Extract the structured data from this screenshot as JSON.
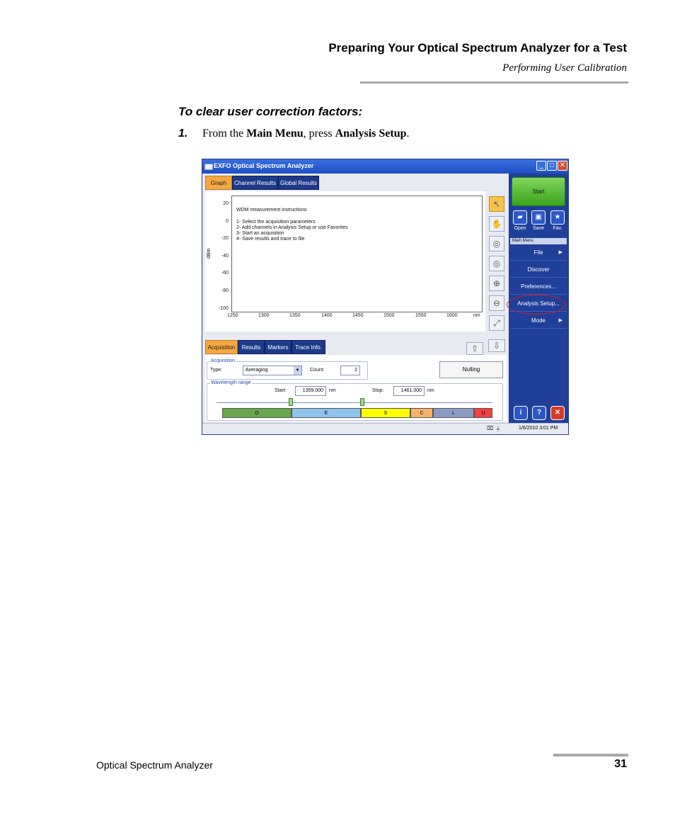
{
  "header": {
    "title": "Preparing Your Optical Spectrum Analyzer for a Test",
    "subtitle": "Performing User Calibration"
  },
  "procedure": {
    "title": "To clear user correction factors:",
    "step_number": "1.",
    "step_pre": "From the ",
    "step_bold1": "Main Menu",
    "step_mid": ", press ",
    "step_bold2": "Analysis Setup",
    "step_end": "."
  },
  "footer": {
    "product": "Optical Spectrum Analyzer",
    "page": "31"
  },
  "app": {
    "window_title": "EXFO Optical Spectrum Analyzer",
    "tabs": [
      "Graph",
      "Channel Results",
      "Global Results"
    ],
    "y_axis_label": "dBm",
    "y_ticks": [
      "20",
      "0",
      "-20",
      "-40",
      "-60",
      "-80",
      "-100"
    ],
    "x_ticks": [
      "1250",
      "1300",
      "1350",
      "1400",
      "1450",
      "1500",
      "1550",
      "1600"
    ],
    "x_unit": "nm",
    "instructions_title": "WDM measurement instructions",
    "instructions": [
      "1- Select the acquisition parameters",
      "2- Add channels in Analysis Setup or use Favorites",
      "3- Start an acquisition",
      "4- Save results and trace to file"
    ],
    "start_label": "Start",
    "quick_buttons": [
      "Open",
      "Save",
      "Fav."
    ],
    "main_menu_header": "Main Menu",
    "main_menu_items": [
      "File",
      "Discover",
      "Preferences...",
      "Analysis Setup...",
      "Mode"
    ],
    "bottom_tabs": [
      "Acquisition",
      "Results",
      "Markers",
      "Trace Info."
    ],
    "acquisition": {
      "group_label": "Acquisition",
      "type_label": "Type:",
      "type_value": "Averaging",
      "count_label": "Count:",
      "count_value": "2",
      "nulling_label": "Nulling"
    },
    "wavelength": {
      "group_label": "Wavelength range",
      "start_label": "Start:",
      "start_value": "1359.000",
      "stop_label": "Stop:",
      "stop_value": "1461.000",
      "unit": "nm"
    },
    "bands": [
      {
        "label": "O",
        "color": "#6aa84f"
      },
      {
        "label": "E",
        "color": "#8ec4ee"
      },
      {
        "label": "S",
        "color": "#ffff00"
      },
      {
        "label": "C",
        "color": "#f7b26b"
      },
      {
        "label": "L",
        "color": "#8c9cc4"
      },
      {
        "label": "U",
        "color": "#f04040"
      }
    ],
    "status_time": "1/6/2010 3:01 PM"
  }
}
